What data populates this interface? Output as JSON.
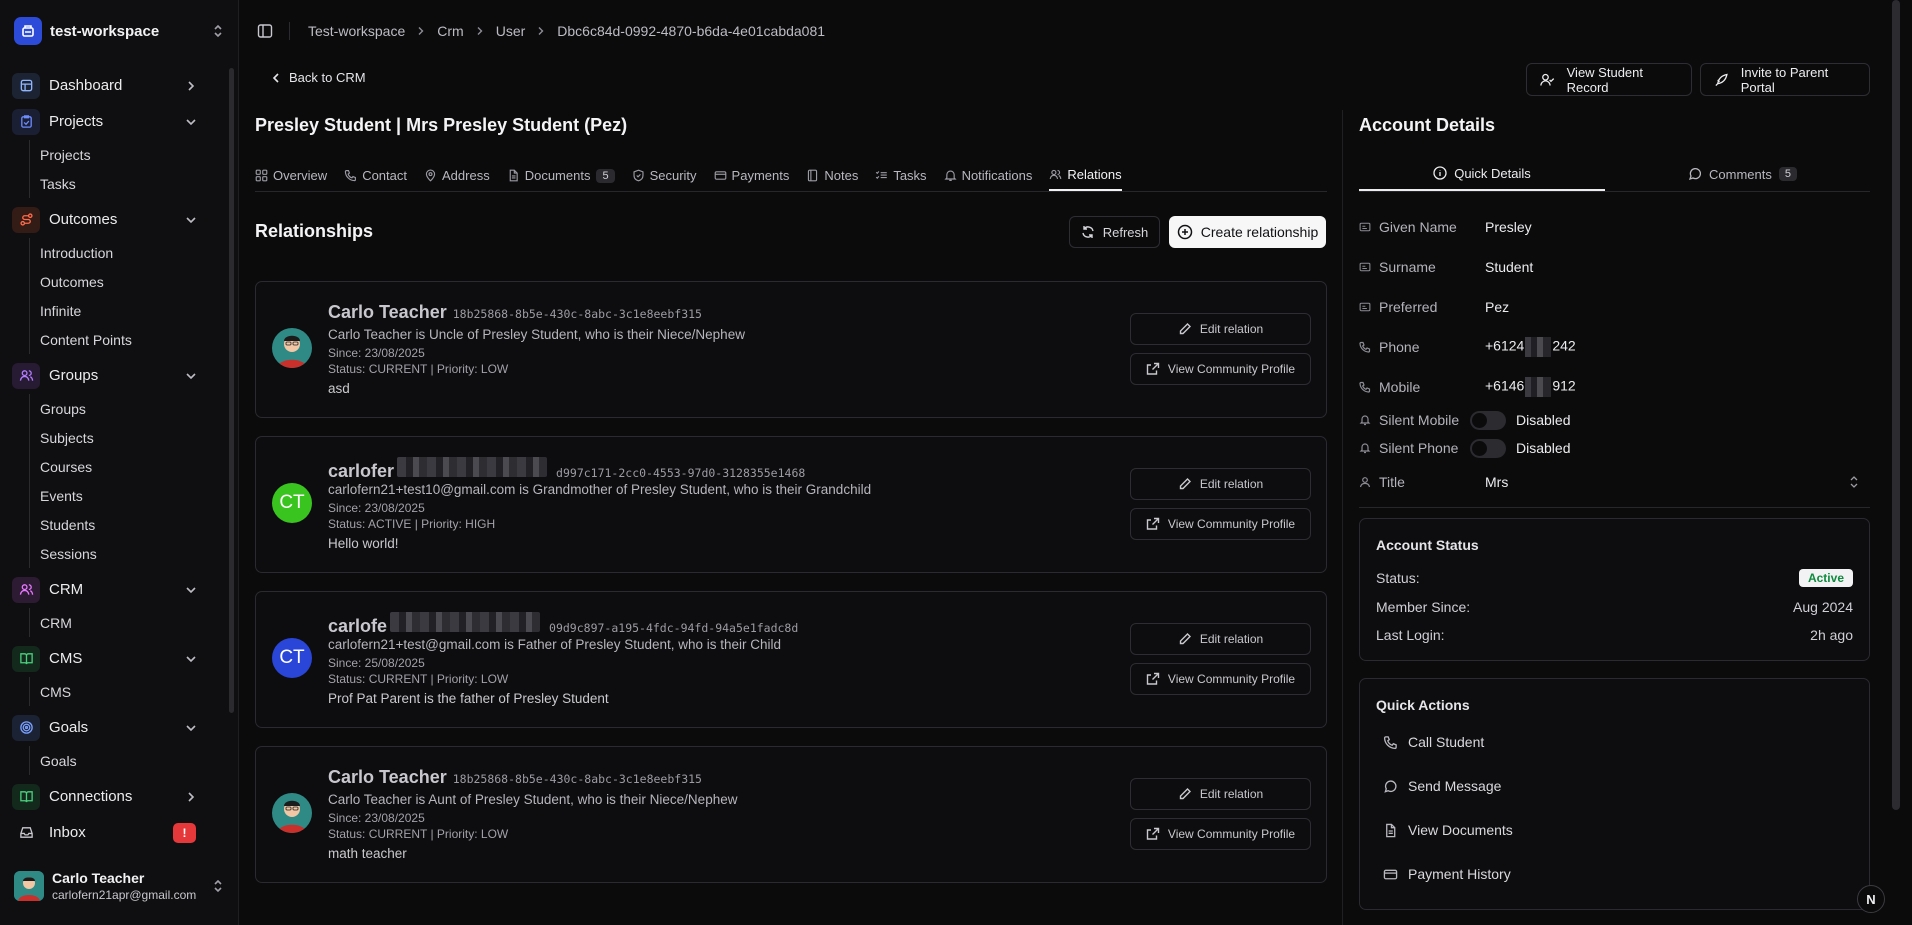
{
  "workspace": {
    "name": "test-workspace"
  },
  "sidebar": {
    "items": [
      {
        "label": "Dashboard",
        "icon": "dashboard-icon",
        "color": "#8fb5ff",
        "bg": "#1c2433",
        "expanded": false
      },
      {
        "label": "Projects",
        "icon": "clipboard-check-icon",
        "color": "#6c8cff",
        "bg": "#1a1f33",
        "expanded": true,
        "sub": [
          "Projects",
          "Tasks"
        ]
      },
      {
        "label": "Outcomes",
        "icon": "route-icon",
        "color": "#ff6b4a",
        "bg": "#331b16",
        "expanded": true,
        "sub": [
          "Introduction",
          "Outcomes",
          "Infinite",
          "Content Points"
        ]
      },
      {
        "label": "Groups",
        "icon": "users-icon",
        "color": "#b37bff",
        "bg": "#261b33",
        "expanded": true,
        "sub": [
          "Groups",
          "Subjects",
          "Courses",
          "Events",
          "Students",
          "Sessions"
        ]
      },
      {
        "label": "CRM",
        "icon": "user-group-icon",
        "color": "#e777ff",
        "bg": "#2d1a33",
        "expanded": true,
        "sub": [
          "CRM"
        ]
      },
      {
        "label": "CMS",
        "icon": "book-icon",
        "color": "#4bd07e",
        "bg": "#13291c",
        "expanded": true,
        "sub": [
          "CMS"
        ]
      },
      {
        "label": "Goals",
        "icon": "target-icon",
        "color": "#7aa0ff",
        "bg": "#1b2233",
        "expanded": true,
        "sub": [
          "Goals"
        ]
      },
      {
        "label": "Connections",
        "icon": "book-open-icon",
        "color": "#4bd07e",
        "bg": "#13291c",
        "expanded": false
      },
      {
        "label": "Inbox",
        "icon": "inbox-icon",
        "color": "#c9c9cf",
        "bg": "transparent",
        "expanded": false,
        "badge": "!"
      }
    ],
    "user": {
      "name": "Carlo Teacher",
      "email": "carlofern21apr@gmail.com"
    }
  },
  "breadcrumb": [
    "Test-workspace",
    "Crm",
    "User",
    "Dbc6c84d-0992-4870-b6da-4e01cabda081"
  ],
  "header": {
    "back_label": "Back to CRM",
    "view_record_label": "View Student Record",
    "invite_label": "Invite to Parent Portal",
    "title": "Presley Student | Mrs Presley Student (Pez)"
  },
  "tabs": [
    {
      "label": "Overview",
      "icon": "grid-icon"
    },
    {
      "label": "Contact",
      "icon": "phone-icon"
    },
    {
      "label": "Address",
      "icon": "map-pin-icon"
    },
    {
      "label": "Documents",
      "icon": "file-icon",
      "count": "5"
    },
    {
      "label": "Security",
      "icon": "shield-icon"
    },
    {
      "label": "Payments",
      "icon": "credit-card-icon"
    },
    {
      "label": "Notes",
      "icon": "note-icon"
    },
    {
      "label": "Tasks",
      "icon": "list-check-icon"
    },
    {
      "label": "Notifications",
      "icon": "bell-icon"
    },
    {
      "label": "Relations",
      "icon": "users-icon",
      "active": true
    }
  ],
  "relationships": {
    "title": "Relationships",
    "refresh_label": "Refresh",
    "create_label": "Create relationship",
    "edit_label": "Edit relation",
    "view_label": "View Community Profile",
    "cards": [
      {
        "name": "Carlo Teacher",
        "redacted": false,
        "id": "18b25868-8b5e-430c-8abc-3c1e8eebf315",
        "desc": "Carlo Teacher is Uncle of Presley Student, who is their Niece/Nephew",
        "since": "Since: 23/08/2025",
        "status": "Status: CURRENT | Priority: LOW",
        "note": "asd",
        "avatar": "photo"
      },
      {
        "name": "carlofer",
        "redacted": true,
        "id": "d997c171-2cc0-4553-97d0-3128355e1468",
        "desc": "carlofern21+test10@gmail.com is Grandmother of Presley Student, who is their Grandchild",
        "since": "Since: 23/08/2025",
        "status": "Status: ACTIVE | Priority: HIGH",
        "note": "Hello world!",
        "avatar": "initials",
        "initials": "CT",
        "avatar_color": "#3ac41f"
      },
      {
        "name": "carlofe",
        "redacted": true,
        "id": "09d9c897-a195-4fdc-94fd-94a5e1fadc8d",
        "desc": "carlofern21+test@gmail.com is Father of Presley Student, who is their Child",
        "since": "Since: 25/08/2025",
        "status": "Status: CURRENT | Priority: LOW",
        "note": "Prof Pat Parent is the father of Presley Student",
        "avatar": "initials",
        "initials": "CT",
        "avatar_color": "#2a46d8"
      },
      {
        "name": "Carlo Teacher",
        "redacted": false,
        "id": "18b25868-8b5e-430c-8abc-3c1e8eebf315",
        "desc": "Carlo Teacher is Aunt of Presley Student, who is their Niece/Nephew",
        "since": "Since: 23/08/2025",
        "status": "Status: CURRENT | Priority: LOW",
        "note": "math teacher",
        "avatar": "photo"
      }
    ]
  },
  "account": {
    "title": "Account Details",
    "tab_quick": "Quick Details",
    "tab_comments": "Comments",
    "comments_count": "5",
    "fields": [
      {
        "label": "Given Name",
        "value": "Presley",
        "icon": "id-card-icon"
      },
      {
        "label": "Surname",
        "value": "Student",
        "icon": "id-card-icon"
      },
      {
        "label": "Preferred",
        "value": "Pez",
        "icon": "id-card-icon"
      }
    ],
    "phone": {
      "label": "Phone",
      "prefix": "+6124",
      "suffix": "242"
    },
    "mobile": {
      "label": "Mobile",
      "prefix": "+6146",
      "suffix": "912"
    },
    "silent_mobile": {
      "label": "Silent Mobile",
      "value": "Disabled"
    },
    "silent_phone": {
      "label": "Silent Phone",
      "value": "Disabled"
    },
    "title_field": {
      "label": "Title",
      "value": "Mrs"
    },
    "status_box": {
      "title": "Account Status",
      "status_label": "Status:",
      "status_value": "Active",
      "member_label": "Member Since:",
      "member_value": "Aug 2024",
      "login_label": "Last Login:",
      "login_value": "2h ago"
    },
    "quick_actions": {
      "title": "Quick Actions",
      "items": [
        {
          "label": "Call Student",
          "icon": "phone-icon"
        },
        {
          "label": "Send Message",
          "icon": "message-icon"
        },
        {
          "label": "View Documents",
          "icon": "file-icon"
        },
        {
          "label": "Payment History",
          "icon": "credit-card-icon"
        }
      ]
    }
  },
  "floating_badge": "N"
}
